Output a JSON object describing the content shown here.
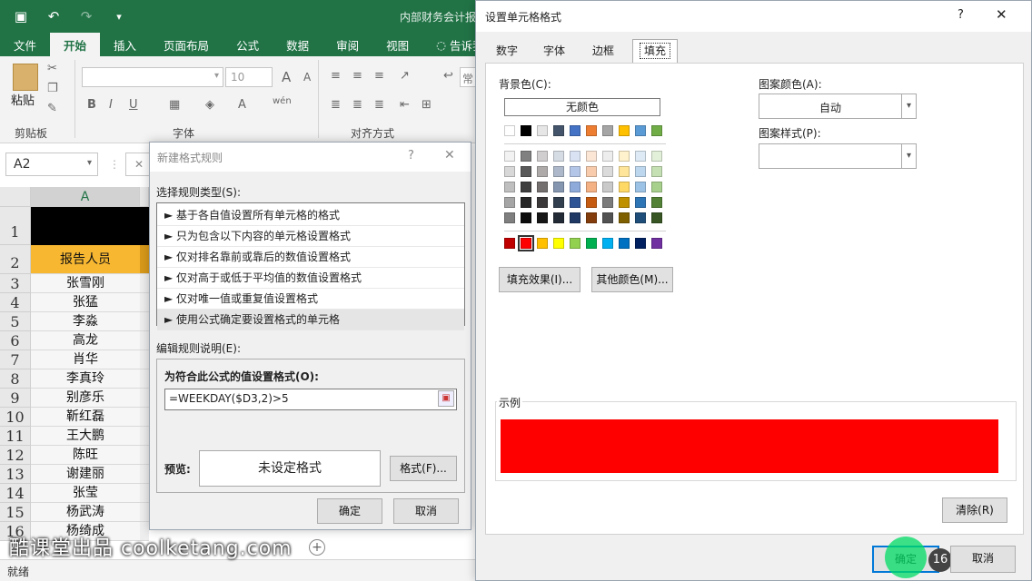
{
  "excel": {
    "title": "内部财务会计报",
    "tabs": [
      "文件",
      "开始",
      "插入",
      "页面布局",
      "公式",
      "数据",
      "审阅",
      "视图",
      "告诉我"
    ],
    "active_tab": "开始",
    "ribbon": {
      "paste_label": "粘贴",
      "clipboard_label": "剪贴板",
      "font_label": "字体",
      "align_label": "对齐方式",
      "font_size": "10",
      "wen_label": "wén",
      "partial_label": "常"
    },
    "name_box": "A2",
    "fx_partial": "✕",
    "column_a": "A",
    "row1_num": "1",
    "header_cell": "报告人员",
    "rows": [
      {
        "num": "2",
        "name": "报告人员"
      },
      {
        "num": "3",
        "name": "张雪刚"
      },
      {
        "num": "4",
        "name": "张猛"
      },
      {
        "num": "5",
        "name": "李淼"
      },
      {
        "num": "6",
        "name": "高龙"
      },
      {
        "num": "7",
        "name": "肖华"
      },
      {
        "num": "8",
        "name": "李真玲"
      },
      {
        "num": "9",
        "name": "别彦乐"
      },
      {
        "num": "10",
        "name": "靳红磊"
      },
      {
        "num": "11",
        "name": "王大鹏"
      },
      {
        "num": "12",
        "name": "陈旺"
      },
      {
        "num": "13",
        "name": "谢建丽"
      },
      {
        "num": "14",
        "name": "张莹"
      },
      {
        "num": "15",
        "name": "杨武涛"
      },
      {
        "num": "16",
        "name": "杨绮成"
      }
    ],
    "status": "就绪",
    "watermark": "酷课堂出品 coolketang.com"
  },
  "new_rule_dialog": {
    "title": "新建格式规则",
    "help": "?",
    "close": "✕",
    "select_type_label": "选择规则类型(S):",
    "rule_types": [
      "► 基于各自值设置所有单元格的格式",
      "► 只为包含以下内容的单元格设置格式",
      "► 仅对排名靠前或靠后的数值设置格式",
      "► 仅对高于或低于平均值的数值设置格式",
      "► 仅对唯一值或重复值设置格式",
      "► 使用公式确定要设置格式的单元格"
    ],
    "edit_desc_label": "编辑规则说明(E):",
    "formula_label": "为符合此公式的值设置格式(O):",
    "formula_value": "=WEEKDAY($D3,2)>5",
    "preview_label": "预览:",
    "preview_text": "未设定格式",
    "format_button": "格式(F)...",
    "ok": "确定",
    "cancel": "取消"
  },
  "format_cells_dialog": {
    "title": "设置单元格格式",
    "help": "?",
    "close": "✕",
    "tabs": [
      "数字",
      "字体",
      "边框",
      "填充"
    ],
    "active_tab": "填充",
    "bg_color_label": "背景色(C):",
    "no_color_button": "无颜色",
    "pattern_color_label": "图案颜色(A):",
    "pattern_color_value": "自动",
    "pattern_style_label": "图案样式(P):",
    "pattern_style_value": "",
    "fill_effects_button": "填充效果(I)...",
    "more_colors_button": "其他颜色(M)...",
    "sample_label": "示例",
    "sample_color": "#ff0000",
    "clear_button": "清除(R)",
    "ok": "确定",
    "cancel": "取消",
    "step_badge": "16",
    "theme_row": [
      "#ffffff",
      "#000000",
      "#e7e6e6",
      "#44546a",
      "#4472c4",
      "#ed7d31",
      "#a5a5a5",
      "#ffc000",
      "#5b9bd5",
      "#70ad47"
    ],
    "tint_rows": [
      [
        "#f2f2f2",
        "#808080",
        "#d0cece",
        "#d6dce4",
        "#d9e2f3",
        "#fbe5d5",
        "#ededed",
        "#fff2cc",
        "#deebf6",
        "#e2efd9"
      ],
      [
        "#d8d8d8",
        "#595959",
        "#aeaaaa",
        "#adb9ca",
        "#b4c6e7",
        "#f7cbac",
        "#dbdbdb",
        "#fee599",
        "#bdd7ee",
        "#c5e0b3"
      ],
      [
        "#bfbfbf",
        "#3f3f3f",
        "#757070",
        "#8496b0",
        "#8eaadb",
        "#f4b183",
        "#c9c9c9",
        "#ffd965",
        "#9cc3e5",
        "#a8d08d"
      ],
      [
        "#a5a5a5",
        "#262626",
        "#3a3838",
        "#323f4f",
        "#2f5496",
        "#c55a11",
        "#7b7b7b",
        "#bf9000",
        "#2e75b5",
        "#538135"
      ],
      [
        "#7f7f7f",
        "#0c0c0c",
        "#171616",
        "#222a35",
        "#1f3864",
        "#833c0b",
        "#525252",
        "#7f6000",
        "#1e4e79",
        "#375623"
      ]
    ],
    "standard_row": [
      "#c00000",
      "#ff0000",
      "#ffc000",
      "#ffff00",
      "#92d050",
      "#00b050",
      "#00b0f0",
      "#0070c0",
      "#002060",
      "#7030a0"
    ],
    "selected_standard": "#ff0000"
  }
}
